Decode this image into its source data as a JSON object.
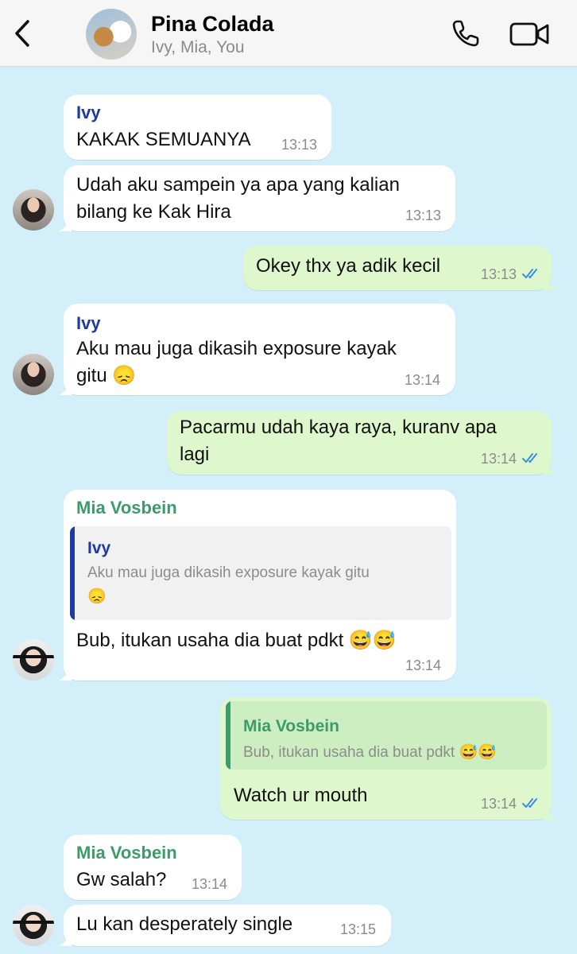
{
  "header": {
    "title": "Pina Colada",
    "members": "Ivy, Mia, You",
    "back_icon": "chevron-left-icon",
    "call_icon": "phone-icon",
    "video_icon": "video-camera-icon"
  },
  "colors": {
    "background": "#d3effa",
    "incoming_bubble": "#ffffff",
    "outgoing_bubble": "#dff7cd",
    "ivy_name": "#1f3aa5",
    "mia_name": "#3d9a6b",
    "read_ticks": "#3b8de8"
  },
  "messages": [
    {
      "sender": "Ivy",
      "text": "KAKAK SEMUANYA",
      "time": "13:13"
    },
    {
      "sender": "",
      "text_line1": "Udah aku sampein ya apa yang kalian",
      "text_line2": "bilang ke Kak Hira",
      "time": "13:13"
    },
    {
      "direction": "out",
      "text": "Okey thx ya adik kecil",
      "time": "13:13",
      "status": "read"
    },
    {
      "sender": "Ivy",
      "text_line1": "Aku mau juga dikasih exposure kayak",
      "text_line2": "gitu 😞",
      "time": "13:14"
    },
    {
      "direction": "out",
      "text_line1": "Pacarmu udah kaya raya, kuranv apa",
      "text_line2": "lagi",
      "time": "13:14",
      "status": "read"
    },
    {
      "sender": "Mia Vosbein",
      "quote_sender": "Ivy",
      "quote_line1": "Aku mau juga dikasih exposure kayak gitu",
      "quote_line2": "😞",
      "text": "Bub, itukan usaha dia buat pdkt 😅😅",
      "time": "13:14"
    },
    {
      "direction": "out",
      "quote_sender": "Mia Vosbein",
      "quote_text": "Bub, itukan usaha dia buat pdkt 😅😅",
      "text": "Watch ur mouth",
      "time": "13:14",
      "status": "read"
    },
    {
      "sender": "Mia Vosbein",
      "text": "Gw salah?",
      "time": "13:14"
    },
    {
      "sender": "",
      "text": "Lu kan desperately single",
      "time": "13:15"
    }
  ]
}
